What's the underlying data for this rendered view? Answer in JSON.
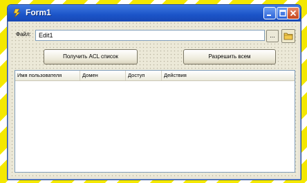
{
  "window": {
    "title": "Form1",
    "controls": {
      "minimize_icon": "minimize-icon",
      "maximize_icon": "maximize-icon",
      "close_icon": "close-icon"
    }
  },
  "form": {
    "file_label": "Файл:",
    "file_input_value": "Edit1",
    "browse_label": "...",
    "folder_icon": "folder-icon",
    "get_acl_label": "Получить ACL список",
    "allow_all_label": "Разрешить всем"
  },
  "list": {
    "columns": [
      "Имя пользователя",
      "Домен",
      "Доступ",
      "Действия"
    ]
  },
  "colors": {
    "titlebar": "#1b54c8",
    "face": "#ece9d8",
    "background_stripe": "#f4e800"
  }
}
